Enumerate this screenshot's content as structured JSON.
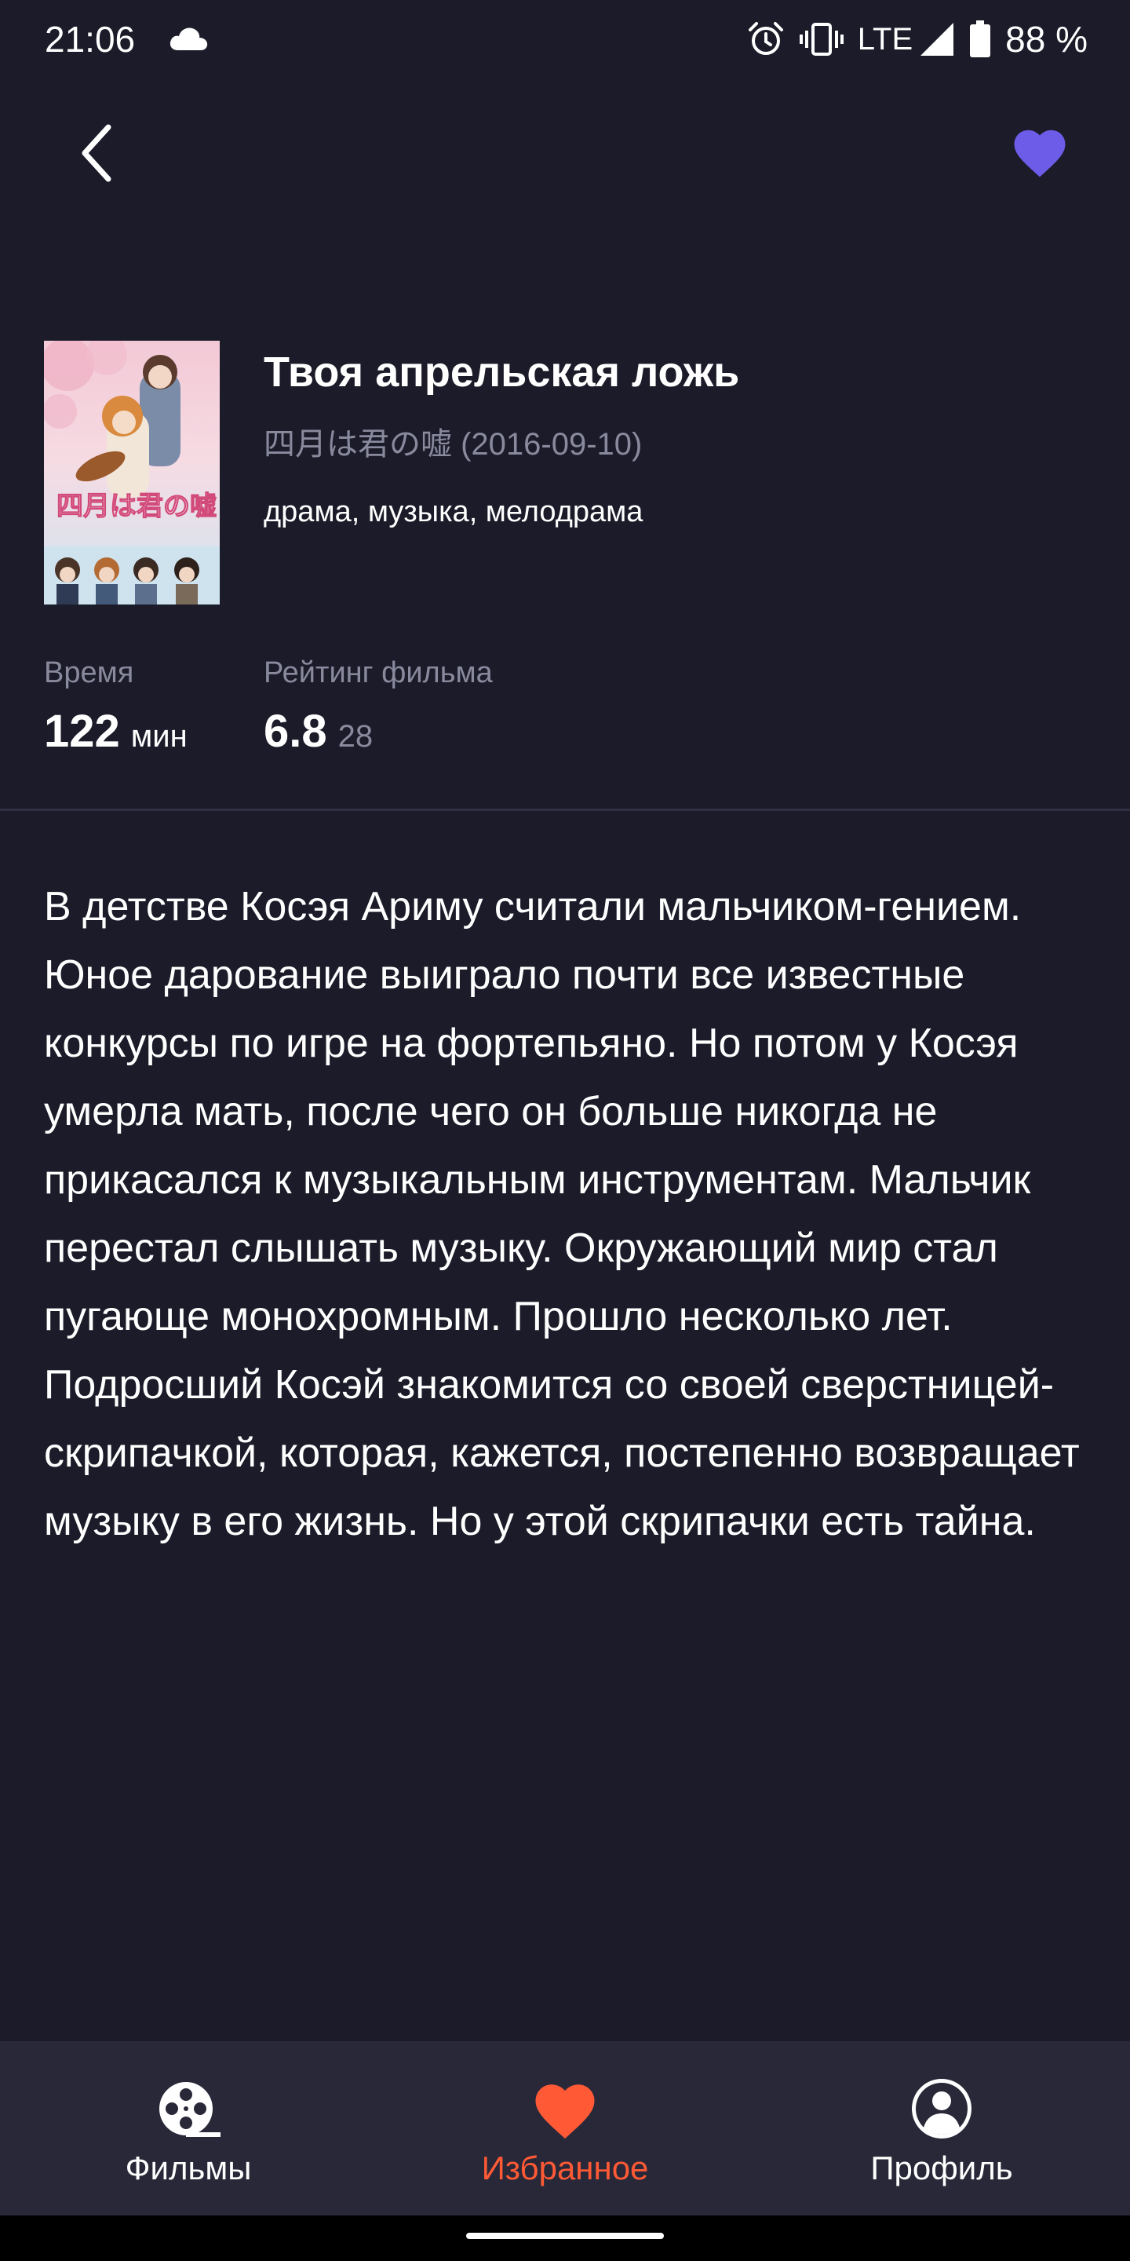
{
  "status_bar": {
    "time": "21:06",
    "network": "LTE",
    "battery": "88 %",
    "icons": [
      "cloud-icon",
      "alarm-icon",
      "vibrate-icon",
      "signal-icon",
      "battery-icon"
    ]
  },
  "app_bar": {
    "back_icon": "chevron-left-icon",
    "favorite_icon": "heart-icon",
    "favorite_color": "#6c5ce7"
  },
  "movie": {
    "title": "Твоя апрельская ложь",
    "original": "四月は君の嘘 (2016-09-10)",
    "genres": "драма, музыка, мелодрама",
    "poster_title": "四月は君の嘘"
  },
  "stats": {
    "duration_label": "Время",
    "duration_value": "122",
    "duration_unit": "мин",
    "rating_label": "Рейтинг фильма",
    "rating_value": "6.8",
    "rating_count": "28"
  },
  "description": "В детстве Косэя Ариму считали мальчиком-гением. Юное дарование выиграло почти все известные конкурсы по игре на фортепьяно. Но потом у Косэя умерла мать, после чего он больше никогда не прикасался к музыкальным инструментам. Мальчик перестал слышать музыку. Окружающий мир стал пугающе монохромным. Прошло несколько лет. Подросший Косэй знакомится со своей сверстницей-скрипачкой, которая, кажется, постепенно возвращает музыку в его жизнь. Но у этой скрипачки есть тайна.",
  "bottom_nav": {
    "items": [
      {
        "label": "Фильмы",
        "icon": "film-reel-icon",
        "active": false
      },
      {
        "label": "Избранное",
        "icon": "heart-icon",
        "active": true
      },
      {
        "label": "Профиль",
        "icon": "profile-icon",
        "active": false
      }
    ],
    "active_color": "#ff5a35"
  }
}
